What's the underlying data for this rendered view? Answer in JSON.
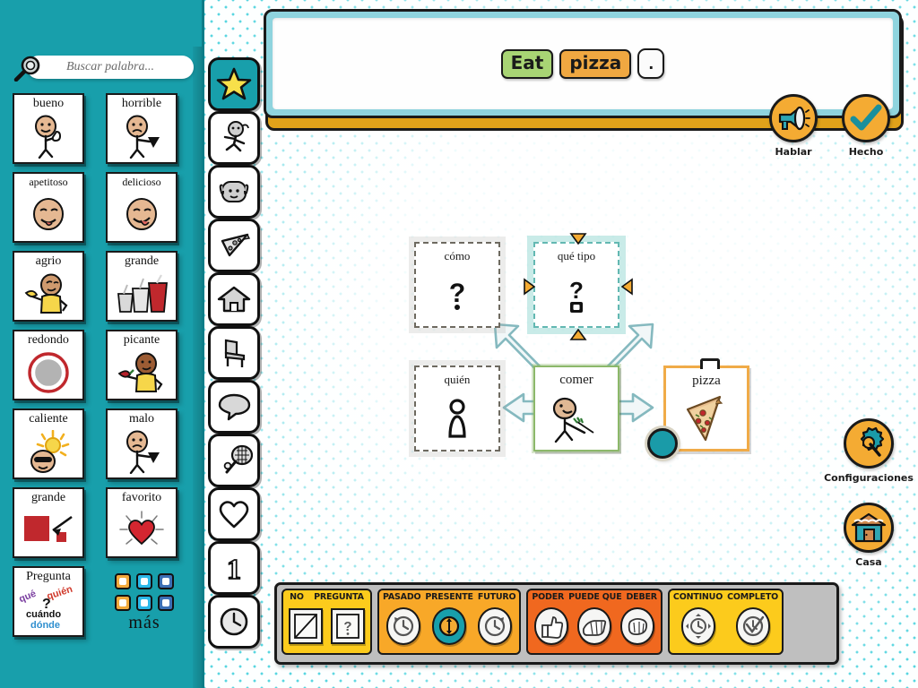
{
  "app": {
    "accent_teal": "#189fab",
    "accent_orange": "#f4ab33",
    "accent_yellow": "#fccb1c",
    "accent_amber": "#f8a828",
    "accent_red_orange": "#f0681f",
    "chip_verb_green": "#a8d474",
    "chip_noun_orange": "#f0a841"
  },
  "search": {
    "placeholder": "Buscar palabra...",
    "value": "",
    "icon": "magnifier-icon"
  },
  "sidebar": {
    "words": [
      {
        "label": "bueno",
        "art": "stick-figure-thumbs-up"
      },
      {
        "label": "horrible",
        "art": "stick-figure-thumbs-down"
      },
      {
        "label": "apetitoso",
        "art": "face-licking-lips"
      },
      {
        "label": "delicioso",
        "art": "face-tongue-out"
      },
      {
        "label": "agrio",
        "art": "person-holding-lemon"
      },
      {
        "label": "grande",
        "art": "three-cups-sizes"
      },
      {
        "label": "redondo",
        "art": "red-ring-circle"
      },
      {
        "label": "picante",
        "art": "person-holding-chili"
      },
      {
        "label": "caliente",
        "art": "sun-and-hot-face"
      },
      {
        "label": "malo",
        "art": "stick-figure-thumbs-down"
      },
      {
        "label": "grande",
        "art": "big-red-square-arrow"
      },
      {
        "label": "favorito",
        "art": "shining-heart"
      },
      {
        "label": "Pregunta",
        "art": "question-words-group"
      }
    ],
    "question_card": {
      "title": "Pregunta",
      "w1": "qué",
      "w2": "quién",
      "w3": "cuándo",
      "w4": "dónde",
      "mark": "?"
    },
    "more": {
      "label": "más",
      "swatch_colors": [
        "#f2a93b",
        "#2bb8e8",
        "#3c6fb5",
        "#f2a93b",
        "#2bb8e8",
        "#3c6fb5"
      ]
    }
  },
  "rail": {
    "items": [
      {
        "name": "favourites",
        "icon": "star-icon",
        "active": true
      },
      {
        "name": "actions",
        "icon": "running-person-icon",
        "active": false
      },
      {
        "name": "people",
        "icon": "face-icon",
        "active": false
      },
      {
        "name": "food",
        "icon": "pizza-slice-icon",
        "active": false
      },
      {
        "name": "places",
        "icon": "house-icon",
        "active": false
      },
      {
        "name": "things",
        "icon": "chair-icon",
        "active": false
      },
      {
        "name": "social",
        "icon": "speech-bubble-icon",
        "active": false
      },
      {
        "name": "activities",
        "icon": "racket-ball-icon",
        "active": false
      },
      {
        "name": "describe",
        "icon": "heart-icon",
        "active": false
      },
      {
        "name": "numbers",
        "icon": "number-one-icon",
        "active": false
      },
      {
        "name": "time",
        "icon": "clock-icon",
        "active": false
      }
    ]
  },
  "sentence": {
    "chips": [
      {
        "text": "Eat",
        "kind": "verb"
      },
      {
        "text": "pizza",
        "kind": "noun"
      },
      {
        "text": ".",
        "kind": "period"
      }
    ]
  },
  "actions": {
    "speak": {
      "label": "Hablar",
      "icon": "megaphone-icon"
    },
    "done": {
      "label": "Hecho",
      "icon": "checkmark-icon"
    },
    "settings": {
      "label": "Configuraciones",
      "icon": "gear-wrench-icon"
    },
    "home": {
      "label": "Casa",
      "icon": "house-icon"
    }
  },
  "diagram": {
    "cards": [
      {
        "label": "cómo",
        "kind": "empty",
        "art": "question-mark",
        "selected": false
      },
      {
        "label": "qué tipo",
        "kind": "selected",
        "art": "question-mark-box",
        "selected": true
      },
      {
        "label": "quién",
        "kind": "empty",
        "art": "person-silhouette",
        "selected": false
      },
      {
        "label": "comer",
        "kind": "verb",
        "art": "person-eating-with-fork",
        "selected": false
      },
      {
        "label": "pizza",
        "kind": "noun",
        "art": "pizza-slice",
        "selected": false
      }
    ],
    "arrows": [
      {
        "from": "comer",
        "to": "cómo"
      },
      {
        "from": "pizza",
        "to": "qué tipo"
      },
      {
        "from": "comer",
        "to": "quién"
      },
      {
        "from": "comer",
        "to": "pizza"
      }
    ]
  },
  "grammar_bar": {
    "groups": [
      {
        "color": "yellow",
        "items": [
          {
            "label": "NO",
            "icon": "crossed-out-square-icon",
            "shape": "square",
            "active": false
          },
          {
            "label": "PREGUNTA",
            "icon": "question-mark-card-icon",
            "shape": "square",
            "active": false
          }
        ]
      },
      {
        "color": "amber",
        "items": [
          {
            "label": "PASADO",
            "icon": "clock-counterclockwise-icon",
            "shape": "oval",
            "active": false
          },
          {
            "label": "PRESENTE",
            "icon": "clock-now-icon",
            "shape": "oval",
            "active": true
          },
          {
            "label": "FUTURO",
            "icon": "clock-clockwise-icon",
            "shape": "oval",
            "active": false
          }
        ]
      },
      {
        "color": "orange",
        "items": [
          {
            "label": "PODER",
            "icon": "thumbs-up-icon",
            "shape": "oval",
            "active": false
          },
          {
            "label": "PUEDE QUE",
            "icon": "flat-hand-icon",
            "shape": "oval",
            "active": false
          },
          {
            "label": "DEBER",
            "icon": "fist-icon",
            "shape": "oval",
            "active": false
          }
        ]
      },
      {
        "color": "yellow",
        "items": [
          {
            "label": "CONTINUO",
            "icon": "cycle-arrows-clock-icon",
            "shape": "oval",
            "active": false
          },
          {
            "label": "COMPLETO",
            "icon": "clock-check-icon",
            "shape": "oval",
            "active": false
          }
        ]
      }
    ]
  }
}
